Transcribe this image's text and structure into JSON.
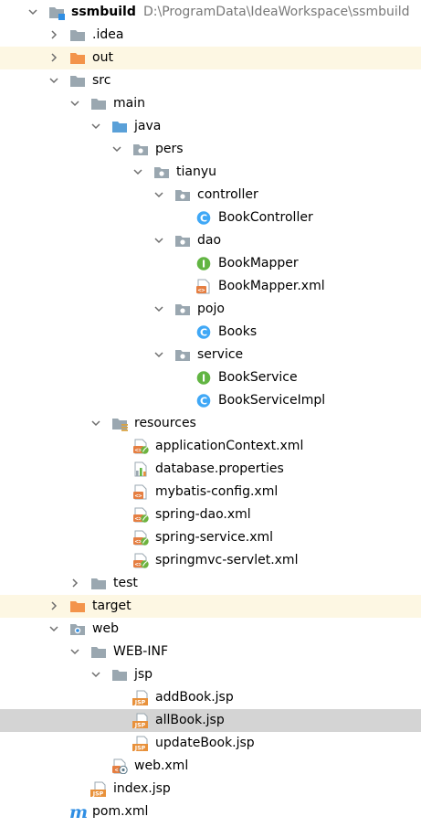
{
  "project": {
    "name": "ssmbuild",
    "path": "D:\\ProgramData\\IdeaWorkspace\\ssmbuild"
  },
  "colors": {
    "folder_gray": "#9aa7b0",
    "folder_excluded": "#f3944b",
    "folder_source": "#5aa0d8",
    "class_blue": "#40a8f6",
    "interface_green": "#62b543",
    "xml_orange": "#e57e41",
    "jsp_orange": "#e8913b",
    "maven_blue": "#2f8ee3",
    "excluded_row_bg": "#fdf7e3",
    "selected_row_bg": "#d4d4d4",
    "path_text": "#787878"
  },
  "tree": [
    {
      "label": "ssmbuild",
      "depth": 0,
      "chevron": "down",
      "icon": "module-folder-icon",
      "bold": true,
      "show_path": true
    },
    {
      "label": ".idea",
      "depth": 1,
      "chevron": "right",
      "icon": "folder-icon"
    },
    {
      "label": "out",
      "depth": 1,
      "chevron": "right",
      "icon": "excluded-folder-icon",
      "excluded": true
    },
    {
      "label": "src",
      "depth": 1,
      "chevron": "down",
      "icon": "folder-icon"
    },
    {
      "label": "main",
      "depth": 2,
      "chevron": "down",
      "icon": "folder-icon"
    },
    {
      "label": "java",
      "depth": 3,
      "chevron": "down",
      "icon": "source-folder-icon"
    },
    {
      "label": "pers",
      "depth": 4,
      "chevron": "down",
      "icon": "package-icon"
    },
    {
      "label": "tianyu",
      "depth": 5,
      "chevron": "down",
      "icon": "package-icon"
    },
    {
      "label": "controller",
      "depth": 6,
      "chevron": "down",
      "icon": "package-icon"
    },
    {
      "label": "BookController",
      "depth": 7,
      "chevron": "none",
      "icon": "java-class-icon"
    },
    {
      "label": "dao",
      "depth": 6,
      "chevron": "down",
      "icon": "package-icon"
    },
    {
      "label": "BookMapper",
      "depth": 7,
      "chevron": "none",
      "icon": "java-interface-icon"
    },
    {
      "label": "BookMapper.xml",
      "depth": 7,
      "chevron": "none",
      "icon": "xml-file-icon"
    },
    {
      "label": "pojo",
      "depth": 6,
      "chevron": "down",
      "icon": "package-icon"
    },
    {
      "label": "Books",
      "depth": 7,
      "chevron": "none",
      "icon": "java-class-icon"
    },
    {
      "label": "service",
      "depth": 6,
      "chevron": "down",
      "icon": "package-icon"
    },
    {
      "label": "BookService",
      "depth": 7,
      "chevron": "none",
      "icon": "java-interface-icon"
    },
    {
      "label": "BookServiceImpl",
      "depth": 7,
      "chevron": "none",
      "icon": "java-class-icon"
    },
    {
      "label": "resources",
      "depth": 3,
      "chevron": "down",
      "icon": "resources-folder-icon"
    },
    {
      "label": "applicationContext.xml",
      "depth": 4,
      "chevron": "none",
      "icon": "spring-xml-icon"
    },
    {
      "label": "database.properties",
      "depth": 4,
      "chevron": "none",
      "icon": "properties-file-icon"
    },
    {
      "label": "mybatis-config.xml",
      "depth": 4,
      "chevron": "none",
      "icon": "xml-file-icon"
    },
    {
      "label": "spring-dao.xml",
      "depth": 4,
      "chevron": "none",
      "icon": "spring-xml-icon"
    },
    {
      "label": "spring-service.xml",
      "depth": 4,
      "chevron": "none",
      "icon": "spring-xml-icon"
    },
    {
      "label": "springmvc-servlet.xml",
      "depth": 4,
      "chevron": "none",
      "icon": "spring-xml-icon"
    },
    {
      "label": "test",
      "depth": 2,
      "chevron": "right",
      "icon": "folder-icon"
    },
    {
      "label": "target",
      "depth": 1,
      "chevron": "right",
      "icon": "excluded-folder-icon",
      "excluded": true
    },
    {
      "label": "web",
      "depth": 1,
      "chevron": "down",
      "icon": "web-folder-icon"
    },
    {
      "label": "WEB-INF",
      "depth": 2,
      "chevron": "down",
      "icon": "folder-icon"
    },
    {
      "label": "jsp",
      "depth": 3,
      "chevron": "down",
      "icon": "folder-icon"
    },
    {
      "label": "addBook.jsp",
      "depth": 4,
      "chevron": "none",
      "icon": "jsp-file-icon"
    },
    {
      "label": "allBook.jsp",
      "depth": 4,
      "chevron": "none",
      "icon": "jsp-file-icon",
      "selected": true
    },
    {
      "label": "updateBook.jsp",
      "depth": 4,
      "chevron": "none",
      "icon": "jsp-file-icon"
    },
    {
      "label": "web.xml",
      "depth": 3,
      "chevron": "none",
      "icon": "web-xml-icon"
    },
    {
      "label": "index.jsp",
      "depth": 2,
      "chevron": "none",
      "icon": "jsp-file-icon"
    },
    {
      "label": "pom.xml",
      "depth": 1,
      "chevron": "none",
      "icon": "maven-pom-icon"
    }
  ]
}
